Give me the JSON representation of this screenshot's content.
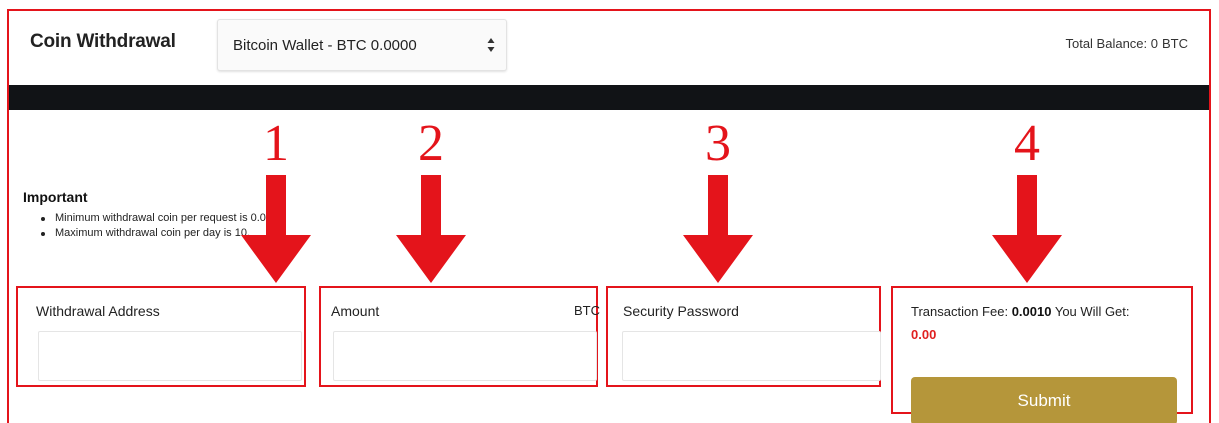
{
  "header": {
    "title": "Coin Withdrawal",
    "wallet_select_value": "Bitcoin Wallet - BTC 0.0000",
    "total_balance_label": "Total Balance: 0",
    "total_balance_currency": "BTC"
  },
  "important": {
    "heading": "Important",
    "items": [
      "Minimum withdrawal coin per request is 0.01.",
      "Maximum withdrawal coin per day is 10."
    ]
  },
  "fields": {
    "withdrawal_address": {
      "label": "Withdrawal Address",
      "value": ""
    },
    "amount": {
      "label": "Amount",
      "unit": "BTC",
      "value": ""
    },
    "security_password": {
      "label": "Security Password",
      "value": ""
    }
  },
  "summary": {
    "fee_label": "Transaction Fee:",
    "fee_value": "0.0010",
    "get_label": "You Will Get:",
    "get_value": "0.00",
    "submit_label": "Submit"
  },
  "annotations": {
    "marker_1": "1",
    "marker_2": "2",
    "marker_3": "3",
    "marker_4": "4"
  },
  "colors": {
    "annotation_red": "#e4141b",
    "submit_gold": "#b5963a",
    "dark_bar": "#111316",
    "get_value_red": "#e02020"
  },
  "icons": {
    "select_arrows": "select-arrows-icon",
    "annotation_arrow": "down-arrow-icon"
  }
}
